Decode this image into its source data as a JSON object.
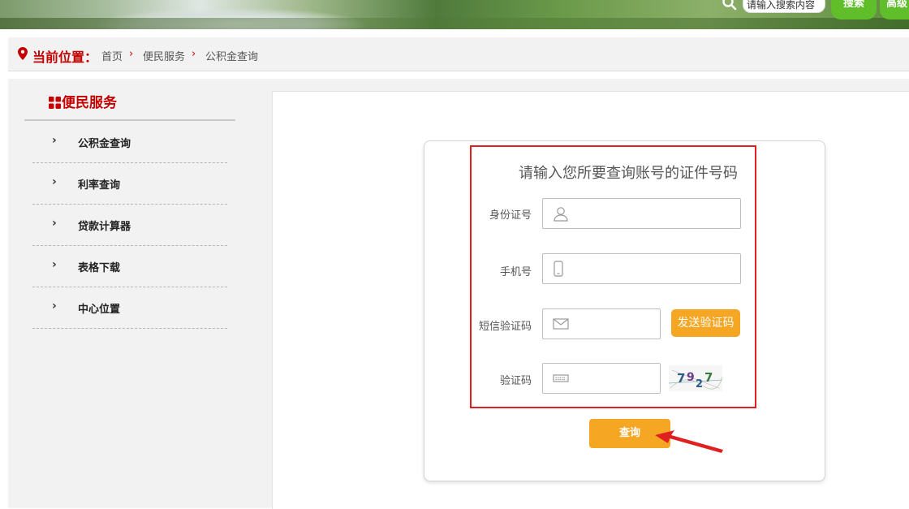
{
  "header": {
    "search_placeholder": "请输入搜索内容",
    "search_label": "搜索",
    "advanced_label": "高级"
  },
  "breadcrumb": {
    "title": "当前位置：",
    "items": [
      "首页",
      "便民服务",
      "公积金查询"
    ]
  },
  "sidebar": {
    "heading": "便民服务",
    "items": [
      {
        "label": "公积金查询"
      },
      {
        "label": "利率查询"
      },
      {
        "label": "贷款计算器"
      },
      {
        "label": "表格下载"
      },
      {
        "label": "中心位置"
      }
    ]
  },
  "form": {
    "title": "请输入您所要查询账号的证件号码",
    "id_label": "身份证号",
    "phone_label": "手机号",
    "sms_label": "短信验证码",
    "sms_button": "发送验证码",
    "captcha_label": "验证码",
    "captcha_text": "7927",
    "submit": "查询"
  },
  "colors": {
    "brand_red": "#c40000",
    "accent_orange": "#f5a623",
    "search_green": "#5fbe2a",
    "annotation_red": "#e02020"
  }
}
